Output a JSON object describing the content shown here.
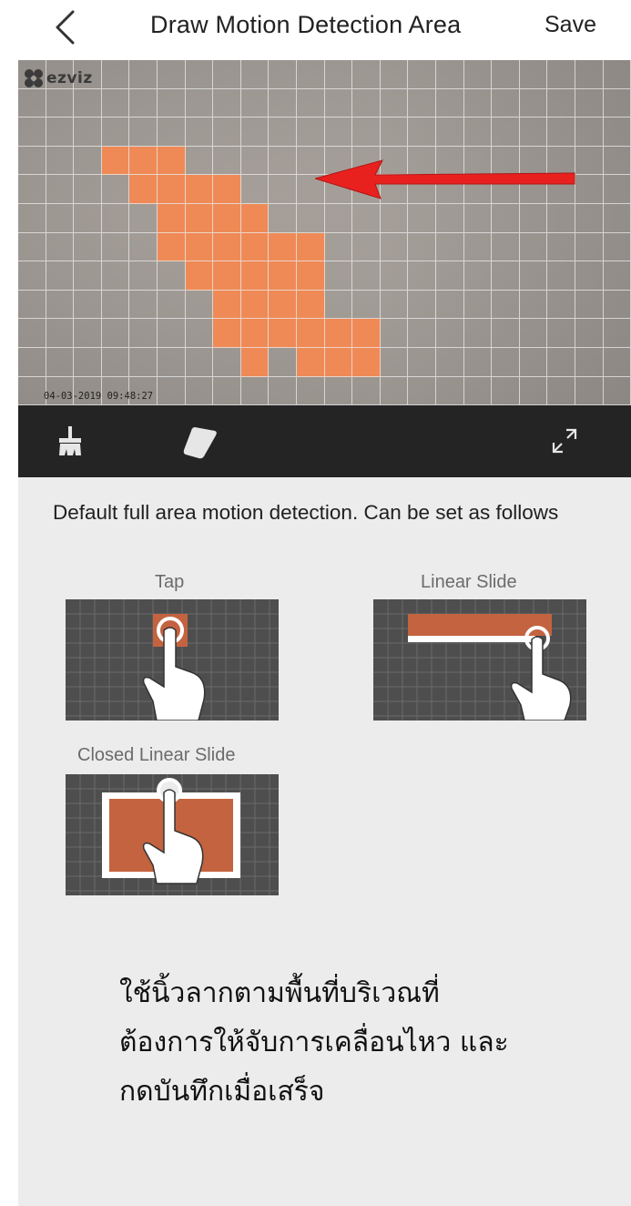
{
  "header": {
    "back_icon": "chevron-left-icon",
    "title": "Draw Motion Detection Area",
    "save_label": "Save"
  },
  "camera": {
    "logo_text": "ezviz",
    "timestamp": "04-03-2019 09:48:27",
    "grid_columns": 22,
    "grid_rows": 12,
    "selected_cells": [
      [
        3,
        3
      ],
      [
        4,
        3
      ],
      [
        5,
        3
      ],
      [
        4,
        4
      ],
      [
        5,
        4
      ],
      [
        6,
        4
      ],
      [
        7,
        4
      ],
      [
        5,
        5
      ],
      [
        6,
        5
      ],
      [
        7,
        5
      ],
      [
        8,
        5
      ],
      [
        5,
        6
      ],
      [
        6,
        6
      ],
      [
        7,
        6
      ],
      [
        8,
        6
      ],
      [
        9,
        6
      ],
      [
        10,
        6
      ],
      [
        6,
        7
      ],
      [
        7,
        7
      ],
      [
        8,
        7
      ],
      [
        9,
        7
      ],
      [
        10,
        7
      ],
      [
        7,
        8
      ],
      [
        8,
        8
      ],
      [
        9,
        8
      ],
      [
        10,
        8
      ],
      [
        7,
        9
      ],
      [
        8,
        9
      ],
      [
        9,
        9
      ],
      [
        10,
        9
      ],
      [
        11,
        9
      ],
      [
        12,
        9
      ],
      [
        8,
        10
      ],
      [
        10,
        10
      ],
      [
        11,
        10
      ],
      [
        12,
        10
      ]
    ],
    "selected_color": "#ef8a56"
  },
  "toolbar": {
    "clear_icon": "broom-icon",
    "eraser_icon": "eraser-icon",
    "fullscreen_icon": "expand-icon"
  },
  "instructions": {
    "description": "Default full area motion detection. Can be set as follows",
    "tap_label": "Tap",
    "linear_slide_label": "Linear Slide",
    "closed_linear_slide_label": "Closed Linear Slide"
  },
  "annotation": {
    "lines": [
      "ใช้นิ้วลากตามพื้นที่บริเวณที่",
      "ต้องการให้จับการเคลื่อนไหว และ",
      "กดบันทึกเมื่อเสร็จ"
    ]
  },
  "colors": {
    "toolbar_bg": "#242424",
    "panel_bg": "#ececec",
    "demo_highlight": "#c4633f"
  }
}
